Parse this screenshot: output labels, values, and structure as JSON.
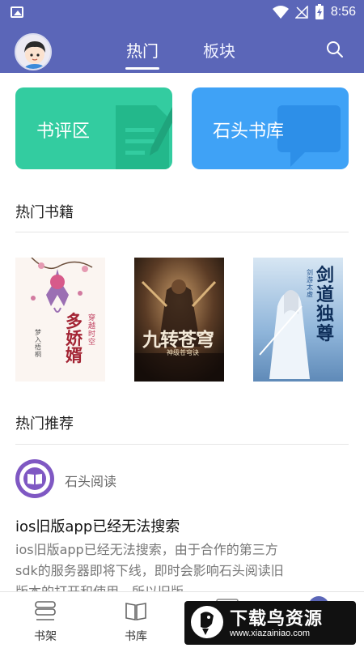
{
  "status_bar": {
    "time": "8:56"
  },
  "header": {
    "tabs": [
      {
        "label": "热门",
        "active": true
      },
      {
        "label": "板块",
        "active": false
      }
    ]
  },
  "cards": [
    {
      "label": "书评区",
      "color": "#33CCA0"
    },
    {
      "label": "石头书库",
      "color": "#3FA2F6"
    }
  ],
  "hot_books": {
    "title": "热门书籍",
    "books": [
      {
        "cover_title": "多娇婿",
        "cover_subtitle": "穿越时空",
        "author": "梦入梧桐",
        "tone": "light floral"
      },
      {
        "cover_title": "九转苍穹",
        "cover_subtitle": "神级苍穹诀",
        "author": "",
        "tone": "dark warrior"
      },
      {
        "cover_title": "剑道独尊",
        "cover_subtitle": "剑游太虚",
        "author": "",
        "tone": "blue swordsman"
      }
    ]
  },
  "hot_recommend": {
    "title": "热门推荐",
    "post": {
      "author": "石头阅读",
      "title": "ios旧版app已经无法搜索",
      "body": "ios旧版app已经无法搜索，由于合作的第三方sdk的服务器即将下线，即时会影响石头阅读旧版本的打开和使用，所以旧版"
    }
  },
  "bottom_nav": [
    {
      "label": "书架",
      "icon": "bookshelf-icon"
    },
    {
      "label": "书库",
      "icon": "book-open-icon"
    }
  ],
  "watermark": {
    "title": "下载鸟资源",
    "url": "www.xiazainiao.com"
  },
  "colors": {
    "primary": "#5B66B8",
    "green": "#33CCA0",
    "blue": "#3FA2F6",
    "purple": "#7F58C3"
  }
}
